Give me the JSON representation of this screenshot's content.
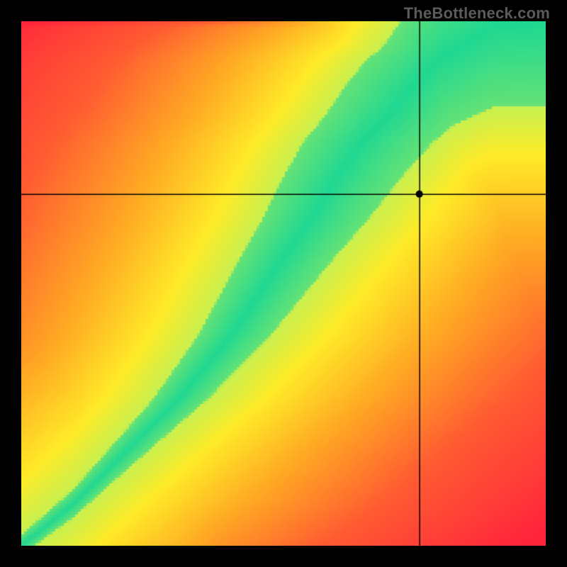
{
  "watermark": "TheBottleneck.com",
  "colors": {
    "black": "#000000",
    "crosshair": "#000000"
  },
  "chart_data": {
    "type": "heatmap",
    "title": "",
    "xlabel": "",
    "ylabel": "",
    "xlim": [
      0,
      1
    ],
    "ylim": [
      0,
      1
    ],
    "crosshair": {
      "x": 0.76,
      "y": 0.67
    },
    "marker": {
      "x": 0.76,
      "y": 0.67
    },
    "optimal_curve_samples": [
      {
        "x": 0.0,
        "y": 0.0
      },
      {
        "x": 0.1,
        "y": 0.08
      },
      {
        "x": 0.2,
        "y": 0.18
      },
      {
        "x": 0.3,
        "y": 0.28
      },
      {
        "x": 0.4,
        "y": 0.4
      },
      {
        "x": 0.5,
        "y": 0.55
      },
      {
        "x": 0.55,
        "y": 0.62
      },
      {
        "x": 0.6,
        "y": 0.7
      },
      {
        "x": 0.65,
        "y": 0.77
      },
      {
        "x": 0.7,
        "y": 0.82
      },
      {
        "x": 0.75,
        "y": 0.88
      },
      {
        "x": 0.8,
        "y": 0.93
      },
      {
        "x": 0.85,
        "y": 0.96
      },
      {
        "x": 0.9,
        "y": 0.99
      },
      {
        "x": 1.0,
        "y": 1.0
      }
    ],
    "band_width_fraction_at_bottom": 0.02,
    "band_width_fraction_at_top": 0.18,
    "scalar_field_description": "distance from optimal curve, 0=on-curve (green) → yellow → orange → red far away"
  }
}
